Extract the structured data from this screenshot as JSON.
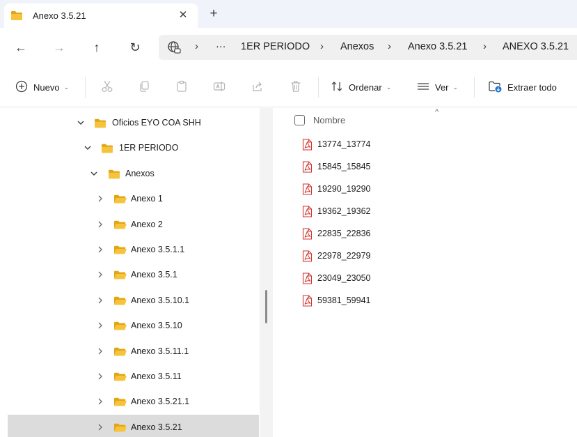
{
  "tab": {
    "title": "Anexo 3.5.21",
    "close_glyph": "✕",
    "new_tab_glyph": "+"
  },
  "nav": {
    "back_icon": "arrow-left-icon",
    "forward_icon": "arrow-right-icon",
    "up_icon": "arrow-up-icon",
    "refresh_icon": "refresh-icon",
    "back_glyph": "←",
    "forward_glyph": "→",
    "up_glyph": "↑",
    "refresh_glyph": "↻"
  },
  "breadcrumb": {
    "overflow": "···",
    "separator": "›",
    "items": [
      "1ER PERIODO",
      "Anexos",
      "Anexo 3.5.21",
      "ANEXO 3.5.21"
    ]
  },
  "commands": {
    "new_label": "Nuevo",
    "sort_label": "Ordenar",
    "view_label": "Ver",
    "extract_label": "Extraer todo"
  },
  "tree": [
    {
      "label": "Oficios EYO COA SHH",
      "level": 0,
      "expanded": true,
      "selected": false
    },
    {
      "label": "1ER PERIODO",
      "level": 1,
      "expanded": true,
      "selected": false
    },
    {
      "label": "Anexos",
      "level": 2,
      "expanded": true,
      "selected": false
    },
    {
      "label": "Anexo 1",
      "level": 3,
      "expanded": false,
      "selected": false
    },
    {
      "label": "Anexo 2",
      "level": 3,
      "expanded": false,
      "selected": false
    },
    {
      "label": "Anexo 3.5.1.1",
      "level": 3,
      "expanded": false,
      "selected": false
    },
    {
      "label": "Anexo 3.5.1",
      "level": 3,
      "expanded": false,
      "selected": false
    },
    {
      "label": "Anexo 3.5.10.1",
      "level": 3,
      "expanded": false,
      "selected": false
    },
    {
      "label": "Anexo 3.5.10",
      "level": 3,
      "expanded": false,
      "selected": false
    },
    {
      "label": "Anexo 3.5.11.1",
      "level": 3,
      "expanded": false,
      "selected": false
    },
    {
      "label": "Anexo 3.5.11",
      "level": 3,
      "expanded": false,
      "selected": false
    },
    {
      "label": "Anexo 3.5.21.1",
      "level": 3,
      "expanded": false,
      "selected": false
    },
    {
      "label": "Anexo 3.5.21",
      "level": 3,
      "expanded": false,
      "selected": true
    }
  ],
  "files": {
    "column_name": "Nombre",
    "items": [
      "13774_13774",
      "15845_15845",
      "19290_19290",
      "19362_19362",
      "22835_22836",
      "22978_22979",
      "23049_23050",
      "59381_59941"
    ]
  },
  "colors": {
    "folder_yellow": "#f6c33c",
    "folder_dark": "#e3a514",
    "pdf_red": "#d0312d",
    "selected_bg": "#dcdcdc",
    "tab_strip_bg": "#f0f3f9"
  }
}
